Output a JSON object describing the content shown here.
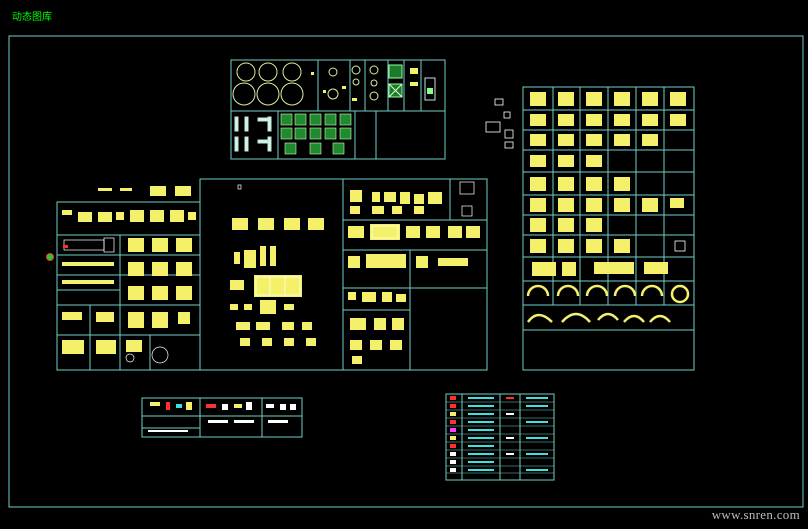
{
  "window": {
    "title": "动态图库",
    "watermark": "www.snren.com"
  },
  "canvas": {
    "background": "#000000",
    "colors": {
      "border": "#6fd0c8",
      "yellow": "#f5f06a",
      "white": "#ffffff",
      "cyan": "#40e0e0",
      "green": "#22cc33",
      "red": "#ff3030",
      "magenta": "#ff40ff",
      "title": "#00ff00"
    }
  }
}
